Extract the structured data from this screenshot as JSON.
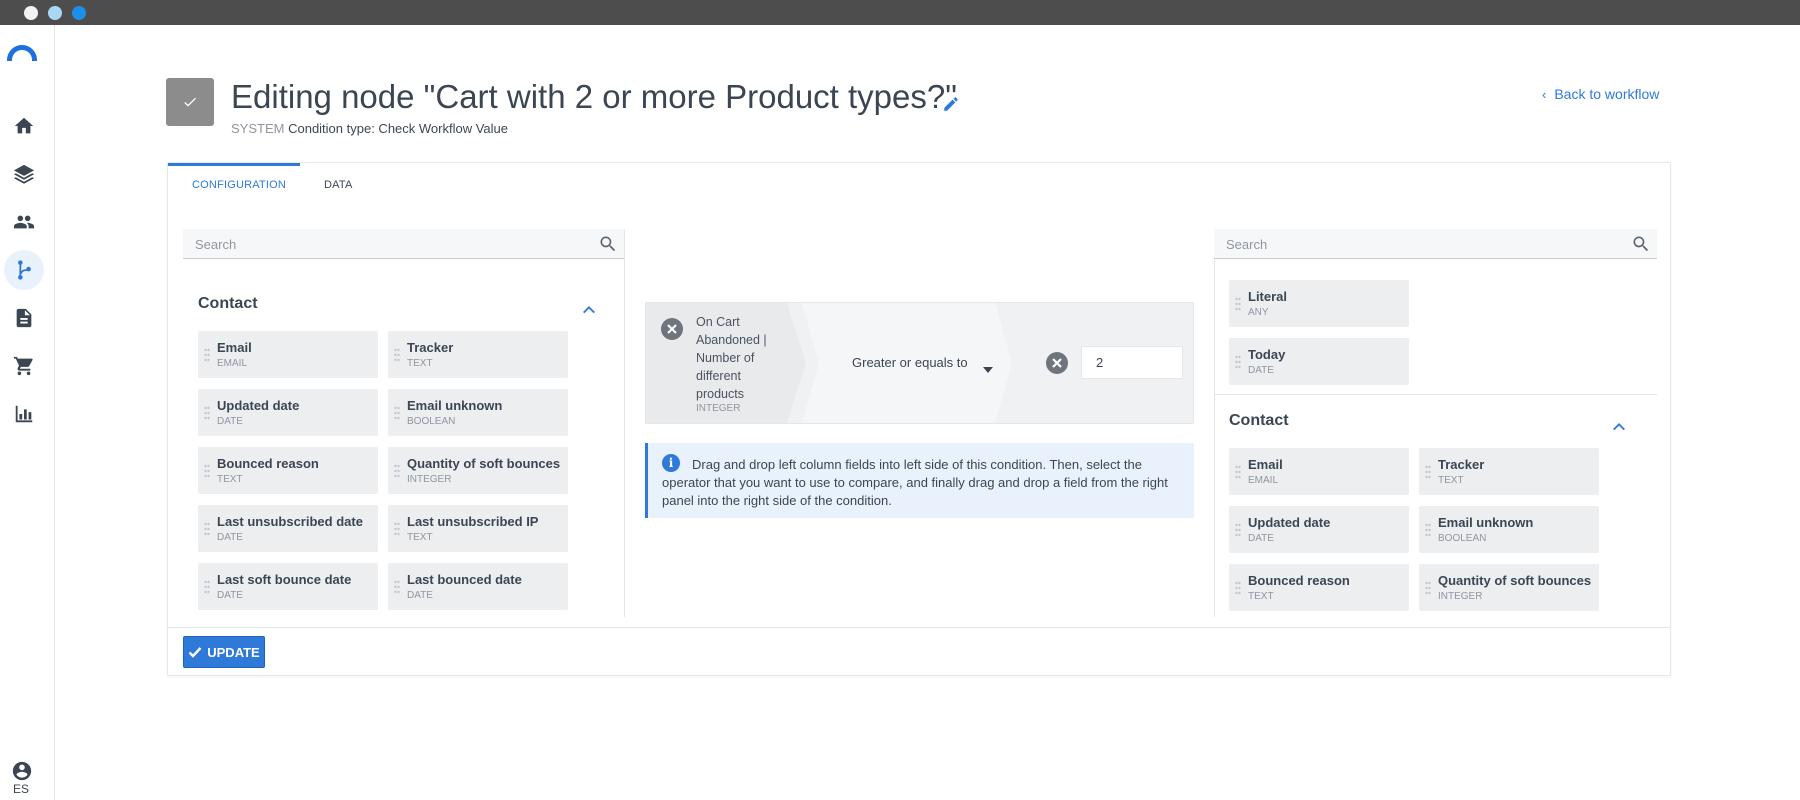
{
  "window": {
    "controls": [
      "close",
      "minimize",
      "maximize"
    ]
  },
  "rail": {
    "items": [
      {
        "name": "home-icon",
        "active": false
      },
      {
        "name": "layers-icon",
        "active": false
      },
      {
        "name": "people-icon",
        "active": false
      },
      {
        "name": "workflow-icon",
        "active": true
      },
      {
        "name": "document-icon",
        "active": false
      },
      {
        "name": "cart-icon",
        "active": false
      },
      {
        "name": "chart-icon",
        "active": false
      }
    ],
    "language": "ES"
  },
  "header": {
    "title": "Editing node \"Cart with 2 or more Product types?\"",
    "system_label": "SYSTEM",
    "condition_type": "Condition type: Check Workflow Value",
    "back_link": "Back to workflow"
  },
  "tabs": [
    {
      "label": "CONFIGURATION",
      "active": true
    },
    {
      "label": "DATA",
      "active": false
    }
  ],
  "left_panel": {
    "search_placeholder": "Search",
    "section_title": "Contact",
    "fields": [
      {
        "name": "Email",
        "type": "EMAIL"
      },
      {
        "name": "Tracker",
        "type": "TEXT"
      },
      {
        "name": "Updated date",
        "type": "DATE"
      },
      {
        "name": "Email unknown",
        "type": "BOOLEAN"
      },
      {
        "name": "Bounced reason",
        "type": "TEXT"
      },
      {
        "name": "Quantity of soft bounces",
        "type": "INTEGER"
      },
      {
        "name": "Last unsubscribed date",
        "type": "DATE"
      },
      {
        "name": "Last unsubscribed IP",
        "type": "TEXT"
      },
      {
        "name": "Last soft bounce date",
        "type": "DATE"
      },
      {
        "name": "Last bounced date",
        "type": "DATE"
      }
    ]
  },
  "condition": {
    "left_field": "On Cart Abandoned | Number of different products",
    "left_type": "INTEGER",
    "operator": "Greater or equals to",
    "value": "2"
  },
  "info": {
    "icon": "info-icon",
    "text": "Drag and drop left column fields into left side of this condition. Then, select the operator that you want to use to compare, and finally drag and drop a field from the right panel into the right side of the condition."
  },
  "right_panel": {
    "search_placeholder": "Search",
    "special_fields": [
      {
        "name": "Literal",
        "type": "ANY"
      },
      {
        "name": "Today",
        "type": "DATE"
      }
    ],
    "section_title": "Contact",
    "fields": [
      {
        "name": "Email",
        "type": "EMAIL"
      },
      {
        "name": "Tracker",
        "type": "TEXT"
      },
      {
        "name": "Updated date",
        "type": "DATE"
      },
      {
        "name": "Email unknown",
        "type": "BOOLEAN"
      },
      {
        "name": "Bounced reason",
        "type": "TEXT"
      },
      {
        "name": "Quantity of soft bounces",
        "type": "INTEGER"
      }
    ]
  },
  "footer": {
    "update_label": "UPDATE"
  },
  "colors": {
    "accent": "#2f7ad8",
    "badge": "#8c8c8c",
    "field_bg": "#edeef0",
    "info_bg": "#e8f1fc"
  }
}
